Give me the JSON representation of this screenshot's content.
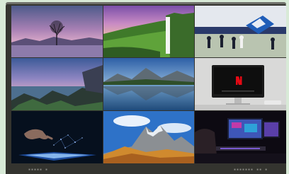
{
  "tiles": [
    {
      "name": "tile-lone-tree-lake",
      "theme": "lone tree in lake at dusk"
    },
    {
      "name": "tile-waterfall-cliff",
      "theme": "waterfall over green cliff"
    },
    {
      "name": "tile-football-game",
      "theme": "football players on field"
    },
    {
      "name": "tile-rocky-coast-dusk",
      "theme": "rocky coast at dusk"
    },
    {
      "name": "tile-mountain-lake",
      "theme": "mountain lake reflection"
    },
    {
      "name": "tile-monitor-netflix",
      "theme": "computer monitor on desk"
    },
    {
      "name": "tile-touch-tablet",
      "theme": "hand touching glowing tablet"
    },
    {
      "name": "tile-mountain-peaks",
      "theme": "rocky mountain peaks under blue sky"
    },
    {
      "name": "tile-gaming-setup",
      "theme": "gaming setup with monitors"
    }
  ],
  "status": {
    "left_text": "▪▪▪▪▪ ▪",
    "right_text": "▪▪▪▪▪▪▪ ▪▪ ▪"
  },
  "colors": {
    "background": "#d8ead7",
    "bezel": "#34342f"
  }
}
